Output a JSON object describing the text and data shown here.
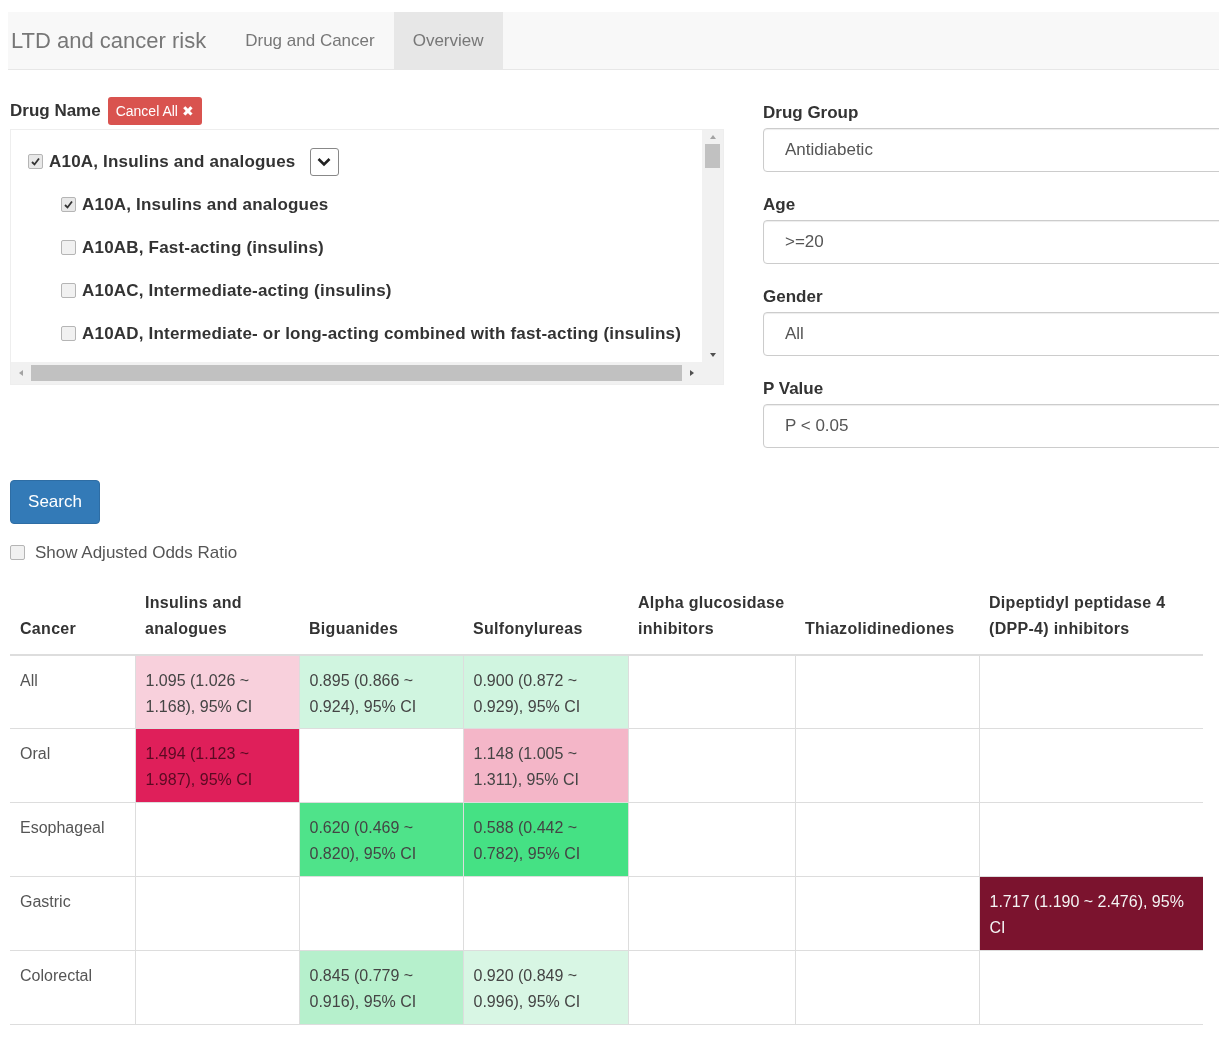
{
  "navbar": {
    "brand": "LTD and cancer risk",
    "tabs": [
      {
        "label": "Drug and Cancer",
        "selected": false
      },
      {
        "label": "Overview",
        "selected": true
      }
    ]
  },
  "drug_name": {
    "label": "Drug Name",
    "cancel_button": "Cancel All ✖",
    "tree": [
      {
        "label": "A10A, Insulins and analogues",
        "checked": true,
        "expanded": true,
        "children": [
          {
            "label": "A10A, Insulins and analogues",
            "checked": true
          },
          {
            "label": "A10AB, Fast-acting (insulins)",
            "checked": false
          },
          {
            "label": "A10AC, Intermediate-acting (insulins)",
            "checked": false
          },
          {
            "label": "A10AD, Intermediate- or long-acting combined with fast-acting (insulins)",
            "checked": false
          }
        ]
      }
    ]
  },
  "filters": [
    {
      "label": "Drug Group",
      "value": "Antidiabetic"
    },
    {
      "label": "Age",
      "value": ">=20"
    },
    {
      "label": "Gender",
      "value": "All"
    },
    {
      "label": "P Value",
      "value": "P < 0.05"
    }
  ],
  "search_button": "Search",
  "adjusted_option": {
    "label": "Show Adjusted Odds Ratio",
    "checked": false
  },
  "table": {
    "columns": [
      "Cancer",
      "Insulins and analogues",
      "Biguanides",
      "Sulfonylureas",
      "Alpha glucosidase inhibitors",
      "Thiazolidinediones",
      "Dipeptidyl peptidase 4 (DPP-4) inhibitors"
    ],
    "rows": [
      [
        "All",
        {
          "text": "1.095 (1.026 ~ 1.168), 95% CI",
          "color": "#f8d0dc"
        },
        {
          "text": "0.895 (0.866 ~ 0.924), 95% CI",
          "color": "#d0f5e0"
        },
        {
          "text": "0.900 (0.872 ~ 0.929), 95% CI",
          "color": "#d0f5e0"
        },
        "",
        "",
        ""
      ],
      [
        "Oral",
        {
          "text": "1.494 (1.123 ~ 1.987), 95% CI",
          "color": "#df1f5a"
        },
        "",
        {
          "text": "1.148 (1.005 ~ 1.311), 95% CI",
          "color": "#f4b6c8"
        },
        "",
        "",
        ""
      ],
      [
        "Esophageal",
        "",
        {
          "text": "0.620 (0.469 ~ 0.820), 95% CI",
          "color": "#4fe38a"
        },
        {
          "text": "0.588 (0.442 ~ 0.782), 95% CI",
          "color": "#45e184"
        },
        "",
        "",
        ""
      ],
      [
        "Gastric",
        "",
        "",
        "",
        "",
        "",
        {
          "text": "1.717 (1.190 ~ 2.476), 95% CI",
          "color": "#7b132e"
        }
      ],
      [
        "Colorectal",
        "",
        {
          "text": "0.845 (0.779 ~ 0.916), 95% CI",
          "color": "#b6f0cc"
        },
        {
          "text": "0.920 (0.849 ~ 0.996), 95% CI",
          "color": "#d8f6e4"
        },
        "",
        "",
        ""
      ]
    ]
  }
}
